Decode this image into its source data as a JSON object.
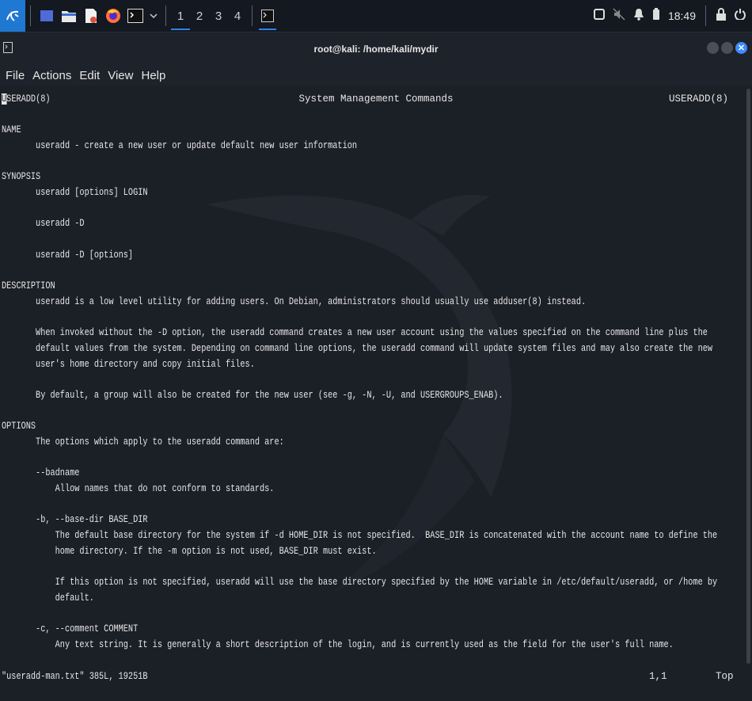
{
  "taskbar": {
    "workspaces": [
      "1",
      "2",
      "3",
      "4"
    ],
    "clock": "18:49"
  },
  "window": {
    "title": "root@kali: /home/kali/mydir",
    "menu": [
      "File",
      "Actions",
      "Edit",
      "View",
      "Help"
    ]
  },
  "man": {
    "header_left_cursor": "U",
    "header_left_rest": "SERADD(8)",
    "header_center": "System Management Commands",
    "header_right": "USERADD(8)",
    "lines": [
      "NAME",
      "       useradd - create a new user or update default new user information",
      "SYNOPSIS",
      "       useradd [options] LOGIN",
      "       useradd -D",
      "       useradd -D [options]",
      "DESCRIPTION",
      "       useradd is a low level utility for adding users. On Debian, administrators should usually use adduser(8) instead.",
      "       When invoked without the -D option, the useradd command creates a new user account using the values specified on the command line plus the",
      "       default values from the system. Depending on command line options, the useradd command will update system files and may also create the new",
      "       user's home directory and copy initial files.",
      "       By default, a group will also be created for the new user (see -g, -N, -U, and USERGROUPS_ENAB).",
      "OPTIONS",
      "       The options which apply to the useradd command are:",
      "       --badname",
      "           Allow names that do not conform to standards.",
      "       -b, --base-dir BASE_DIR",
      "           The default base directory for the system if -d HOME_DIR is not specified.  BASE_DIR is concatenated with the account name to define the",
      "           home directory. If the -m option is not used, BASE_DIR must exist.",
      "           If this option is not specified, useradd will use the base directory specified by the HOME variable in /etc/default/useradd, or /home by",
      "           default.",
      "       -c, --comment COMMENT",
      "           Any text string. It is generally a short description of the login, and is currently used as the field for the user's full name."
    ],
    "status_file": "\"useradd-man.txt\" 385L, 19251B",
    "status_pos": "1,1",
    "status_scroll": "Top"
  }
}
